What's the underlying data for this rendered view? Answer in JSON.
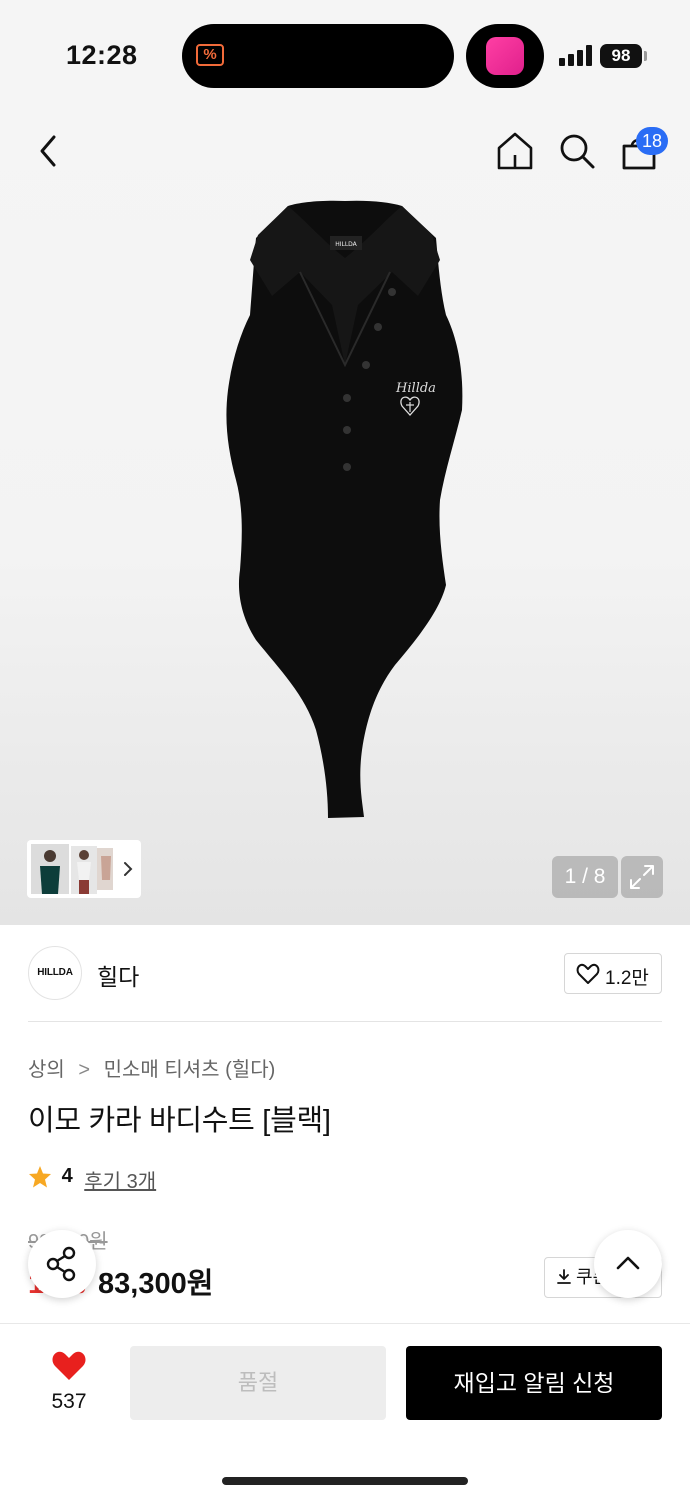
{
  "status_bar": {
    "time": "12:28",
    "battery": "98",
    "island_app_glyph": "%"
  },
  "header": {
    "back_icon": "chevron-left-icon",
    "home_icon": "home-icon",
    "search_icon": "search-icon",
    "cart_icon": "shopping-bag-icon",
    "cart_count": "18"
  },
  "gallery": {
    "page_counter": "1 / 8",
    "thumb_arrow_icon": "chevron-right-icon",
    "expand_icon": "expand-icon"
  },
  "brand": {
    "logo_text": "HILLDA",
    "name": "힐다",
    "likes": "1.2만"
  },
  "product": {
    "breadcrumb": [
      "상의",
      "민소매 티셔츠 (힐다)"
    ],
    "title": "이모 카라 바디수트 [블랙]",
    "rating": "4",
    "reviews_label": "후기 3개",
    "original_price": "98,000원",
    "discount": "15%",
    "price": "83,300원",
    "coupon_label": "쿠폰"
  },
  "actions": {
    "wish_count": "537",
    "soldout_label": "품절",
    "restock_label": "재입고 알림 신청"
  },
  "colors": {
    "accent_blue": "#2a6df5",
    "discount_red": "#e8322f",
    "star": "#f7a823"
  }
}
